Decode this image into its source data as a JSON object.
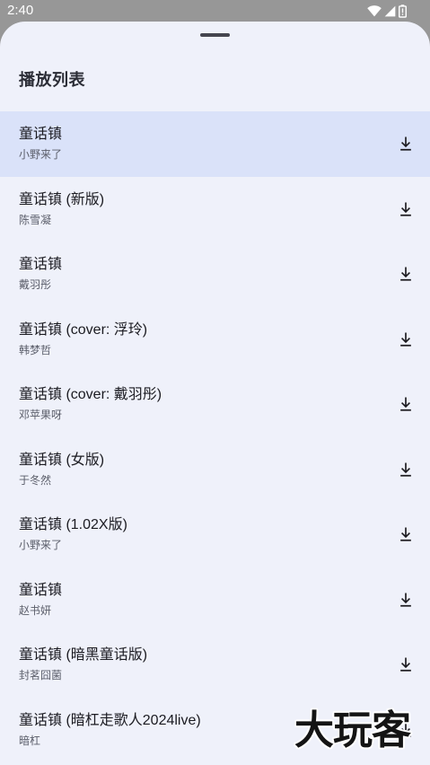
{
  "status_bar": {
    "time": "2:40",
    "icons": [
      "wifi-icon",
      "signal-icon",
      "battery-icon"
    ]
  },
  "sheet": {
    "title": "播放列表"
  },
  "playlist": [
    {
      "title": "童话镇",
      "artist": "小野来了",
      "active": true
    },
    {
      "title": "童话镇 (新版)",
      "artist": "陈雪凝",
      "active": false
    },
    {
      "title": "童话镇",
      "artist": "戴羽彤",
      "active": false
    },
    {
      "title": "童话镇 (cover: 浮玲)",
      "artist": "韩梦哲",
      "active": false
    },
    {
      "title": "童话镇 (cover: 戴羽彤)",
      "artist": "邓苹果呀",
      "active": false
    },
    {
      "title": "童话镇 (女版)",
      "artist": "于冬然",
      "active": false
    },
    {
      "title": "童话镇 (1.02X版)",
      "artist": "小野来了",
      "active": false
    },
    {
      "title": "童话镇",
      "artist": "赵书妍",
      "active": false
    },
    {
      "title": "童话镇 (暗黑童话版)",
      "artist": "封茗囧菌",
      "active": false
    },
    {
      "title": "童话镇 (暗杠走歌人2024live)",
      "artist": "暗杠",
      "active": false
    }
  ],
  "row_action_icon": "download-icon",
  "watermark": {
    "text": "大玩客"
  },
  "colors": {
    "scrim": "#979797",
    "sheet_bg": "#eff1fa",
    "active_row_bg": "#dae2f9",
    "text_primary": "#1b1b21",
    "text_secondary": "#5b5e6a",
    "handle": "#45464f"
  }
}
